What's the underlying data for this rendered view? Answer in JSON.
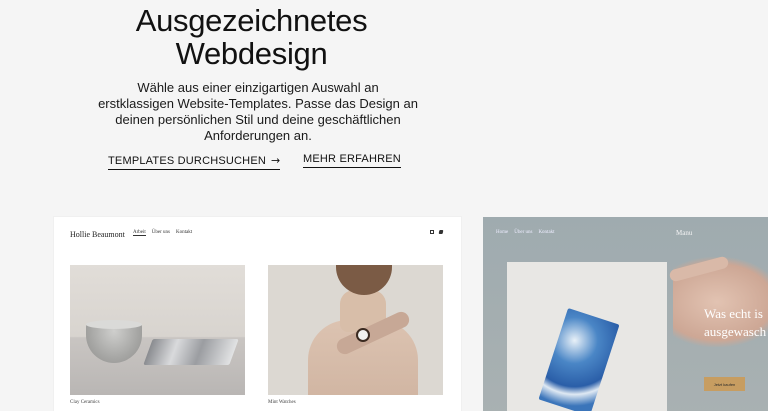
{
  "hero": {
    "title_line1": "Ausgezeichnetes",
    "title_line2": "Webdesign",
    "subtitle_lines": [
      "Wähle aus einer einzigartigen Auswahl an",
      "erstklassigen Website-Templates. Passe das Design an",
      "deinen persönlichen Stil und deine geschäftlichen",
      "Anforderungen an."
    ],
    "cta_browse": "TEMPLATES DURCHSUCHEN",
    "cta_browse_icon": "arrow-right-icon",
    "cta_more": "MEHR ERFAHREN"
  },
  "template1": {
    "brand": "Hollie Beaumont",
    "nav": [
      "Arbeit",
      "Über uns",
      "Kontakt"
    ],
    "social_icons": [
      "instagram-icon",
      "twitter-icon"
    ],
    "caption1": "Clay Ceramics",
    "caption2": "Mint Watches"
  },
  "template2": {
    "nav": [
      "Home",
      "Über uns",
      "Kontakt"
    ],
    "brand": "Manu",
    "headline_line1": "Was echt is",
    "headline_line2": "ausgewasch",
    "button": "Jetzt kaufen"
  },
  "colors": {
    "background": "#f5f5f5",
    "text": "#111111",
    "template2_button": "#c79d61"
  }
}
